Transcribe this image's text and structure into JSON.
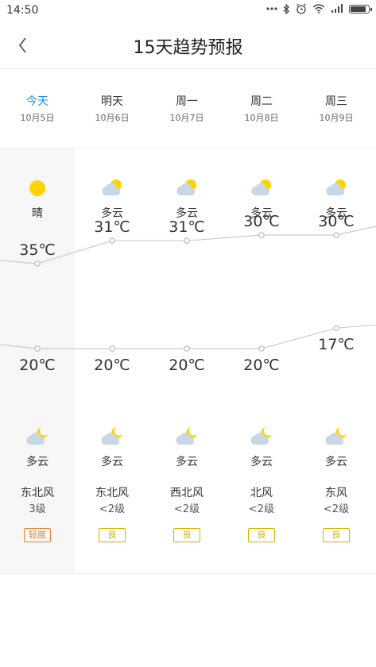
{
  "status_bar": {
    "time": "14:50",
    "icons": [
      "more-dots-icon",
      "bluetooth-icon",
      "alarm-icon",
      "wifi-icon",
      "signal-icon",
      "battery-icon"
    ]
  },
  "header": {
    "title": "15天趋势预报",
    "back_icon": "chevron-left-icon"
  },
  "colors": {
    "today_accent": "#1e90e0",
    "sun": "#ffd400",
    "cloud": "#c9d6e6",
    "aqi_light_pollution": "#e8803a",
    "aqi_good": "#d4b100",
    "chart_line": "#cccccc"
  },
  "days": [
    {
      "day": "今天",
      "date": "10月5日",
      "day_weather": "晴",
      "day_icon": "sun-icon",
      "high": "35℃",
      "low": "20℃",
      "night_icon": "cloudy-moon-icon",
      "night_weather": "多云",
      "wind_dir": "东北风",
      "wind_level": "3级",
      "aqi": "轻度"
    },
    {
      "day": "明天",
      "date": "10月6日",
      "day_weather": "多云",
      "day_icon": "partly-cloudy-icon",
      "high": "31℃",
      "low": "20℃",
      "night_icon": "cloudy-moon-icon",
      "night_weather": "多云",
      "wind_dir": "东北风",
      "wind_level": "<2级",
      "aqi": "良"
    },
    {
      "day": "周一",
      "date": "10月7日",
      "day_weather": "多云",
      "day_icon": "partly-cloudy-icon",
      "high": "31℃",
      "low": "20℃",
      "night_icon": "cloudy-moon-icon",
      "night_weather": "多云",
      "wind_dir": "西北风",
      "wind_level": "<2级",
      "aqi": "良"
    },
    {
      "day": "周二",
      "date": "10月8日",
      "day_weather": "多云",
      "day_icon": "partly-cloudy-icon",
      "high": "30℃",
      "low": "20℃",
      "night_icon": "cloudy-moon-icon",
      "night_weather": "多云",
      "wind_dir": "北风",
      "wind_level": "<2级",
      "aqi": "良"
    },
    {
      "day": "周三",
      "date": "10月9日",
      "day_weather": "多云",
      "day_icon": "partly-cloudy-icon",
      "high": "30℃",
      "low": "17℃",
      "night_icon": "cloudy-moon-icon",
      "night_weather": "多云",
      "wind_dir": "东风",
      "wind_level": "<2级",
      "aqi": "良"
    }
  ],
  "chart_data": {
    "type": "line",
    "x": [
      "今天",
      "明天",
      "周一",
      "周二",
      "周三"
    ],
    "series": [
      {
        "values": [
          35,
          31,
          31,
          30,
          30
        ]
      },
      {
        "values": [
          20,
          20,
          20,
          20,
          17
        ]
      }
    ]
  }
}
